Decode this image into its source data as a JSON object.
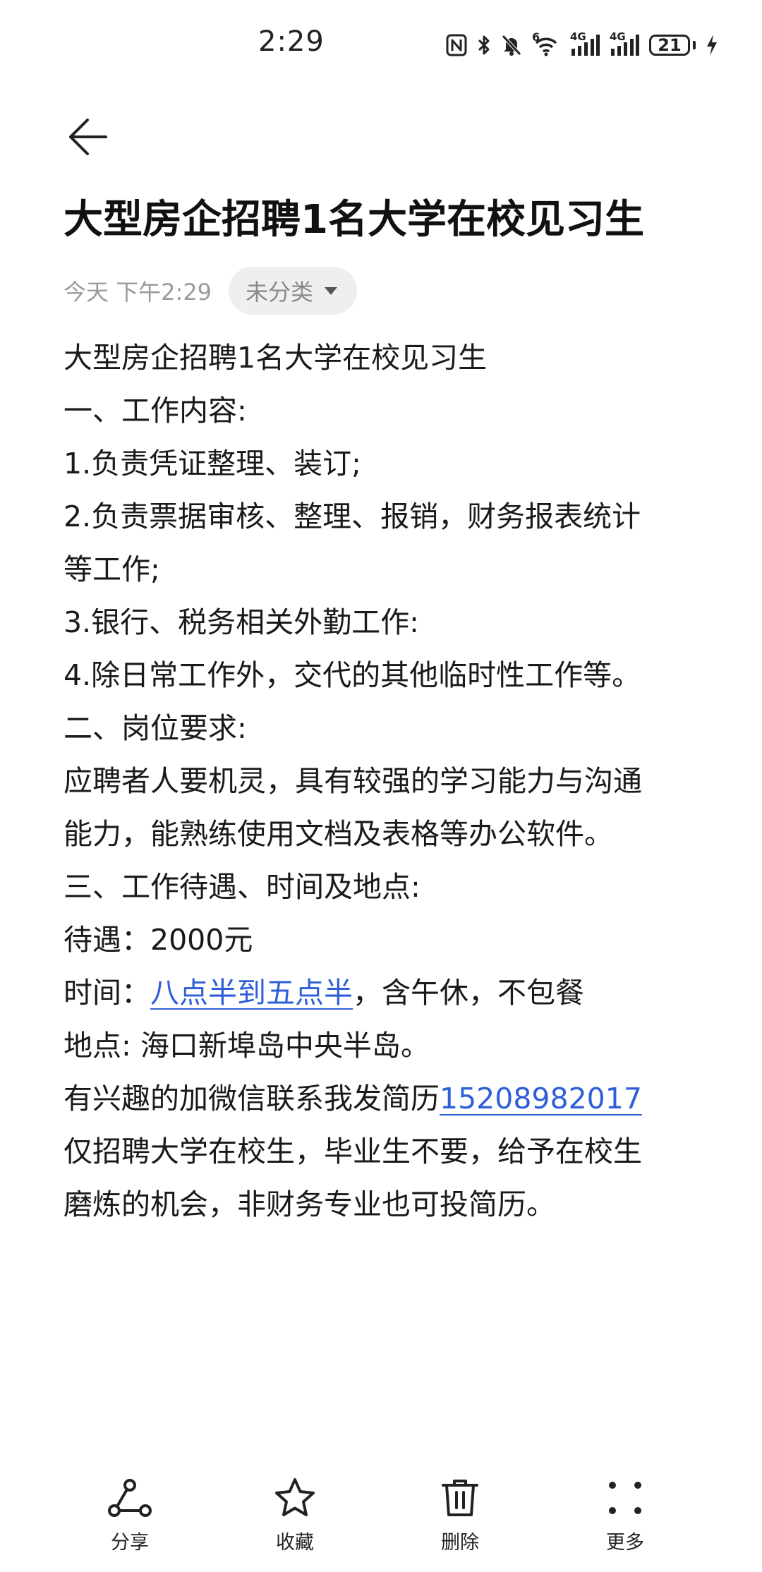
{
  "status_bar": {
    "time": "2:29",
    "signal_label_1": "6",
    "signal_label_2": "4G",
    "signal_label_3": "4G",
    "battery_level": "21",
    "icons": [
      "nfc-icon",
      "bluetooth-icon",
      "mute-icon",
      "wifi-icon",
      "signal-icon",
      "signal-icon",
      "battery-icon",
      "charging-icon"
    ]
  },
  "note": {
    "title": "大型房企招聘1名大学在校见习生",
    "date": "今天 下午2:29",
    "category": "未分类",
    "lines": [
      "大型房企招聘1名大学在校见习生",
      "一、工作内容:",
      "1.负责凭证整理、装订;",
      "2.负责票据审核、整理、报销，财务报表统计",
      "等工作;",
      "3.银行、税务相关外勤工作:",
      "4.除日常工作外，交代的其他临时性工作等。",
      "二、岗位要求:",
      "应聘者人要机灵，具有较强的学习能力与沟通",
      "能力，能熟练使用文档及表格等办公软件。",
      "三、工作待遇、时间及地点:",
      "待遇：2000元"
    ],
    "time_prefix": "时间：",
    "time_link": "八点半到五点半",
    "time_suffix": "，含午休，不包餐",
    "location_line": "地点: 海口新埠岛中央半岛。",
    "contact_prefix": "有兴趣的加微信联系我发简历",
    "contact_phone": "15208982017",
    "tail_lines": [
      "仅招聘大学在校生，毕业生不要，给予在校生",
      "磨炼的机会，非财务专业也可投简历。"
    ]
  },
  "toolbar": {
    "share_label": "分享",
    "favorite_label": "收藏",
    "delete_label": "删除",
    "more_label": "更多"
  }
}
